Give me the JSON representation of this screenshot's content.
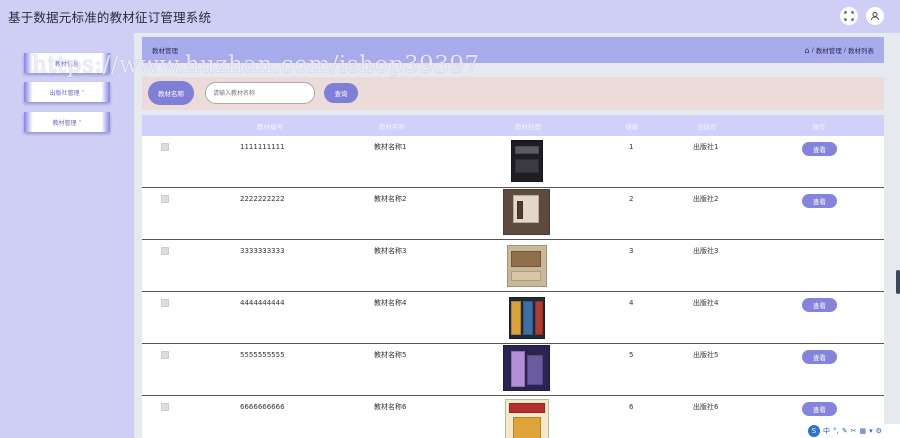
{
  "header": {
    "title": "基于数据元标准的教材征订管理系统",
    "icons": [
      "fullscreen-icon",
      "user-icon"
    ]
  },
  "sidebar": {
    "items": [
      {
        "label": "教材信息"
      },
      {
        "label": "出版社管理 ˅"
      },
      {
        "label": "教材管理 ˅"
      }
    ]
  },
  "breadcrumb": {
    "section": "教材管理",
    "trail": [
      "教材管理",
      "教材列表"
    ],
    "separator": "/"
  },
  "search": {
    "label": "教材名称",
    "placeholder": "请输入教材名称",
    "button": "查询"
  },
  "table": {
    "headers": [
      "教材编号",
      "教材名称",
      "教材封面",
      "册数",
      "出版社",
      "操作"
    ],
    "rows": [
      {
        "code": "1111111111",
        "name": "教材名称1",
        "count": "1",
        "publisher": "出版社1",
        "action": "查看"
      },
      {
        "code": "2222222222",
        "name": "教材名称2",
        "count": "2",
        "publisher": "出版社2",
        "action": "查看"
      },
      {
        "code": "3333333333",
        "name": "教材名称3",
        "count": "3",
        "publisher": "出版社3",
        "action": "查看"
      },
      {
        "code": "4444444444",
        "name": "教材名称4",
        "count": "4",
        "publisher": "出版社4",
        "action": "查看"
      },
      {
        "code": "5555555555",
        "name": "教材名称5",
        "count": "5",
        "publisher": "出版社5",
        "action": "查看"
      },
      {
        "code": "6666666666",
        "name": "教材名称6",
        "count": "6",
        "publisher": "出版社6",
        "action": "查看"
      }
    ]
  },
  "watermark": "https://www.huzhan.com/ishop39397",
  "tray": {
    "logo": "S",
    "lang": "中"
  },
  "colors": {
    "topbar": "#cfcff6",
    "accent": "#8484dc",
    "table_header": "#d0d0fa",
    "breadcrumb": "#a9acec",
    "search_bg": "#ebdcd9"
  }
}
